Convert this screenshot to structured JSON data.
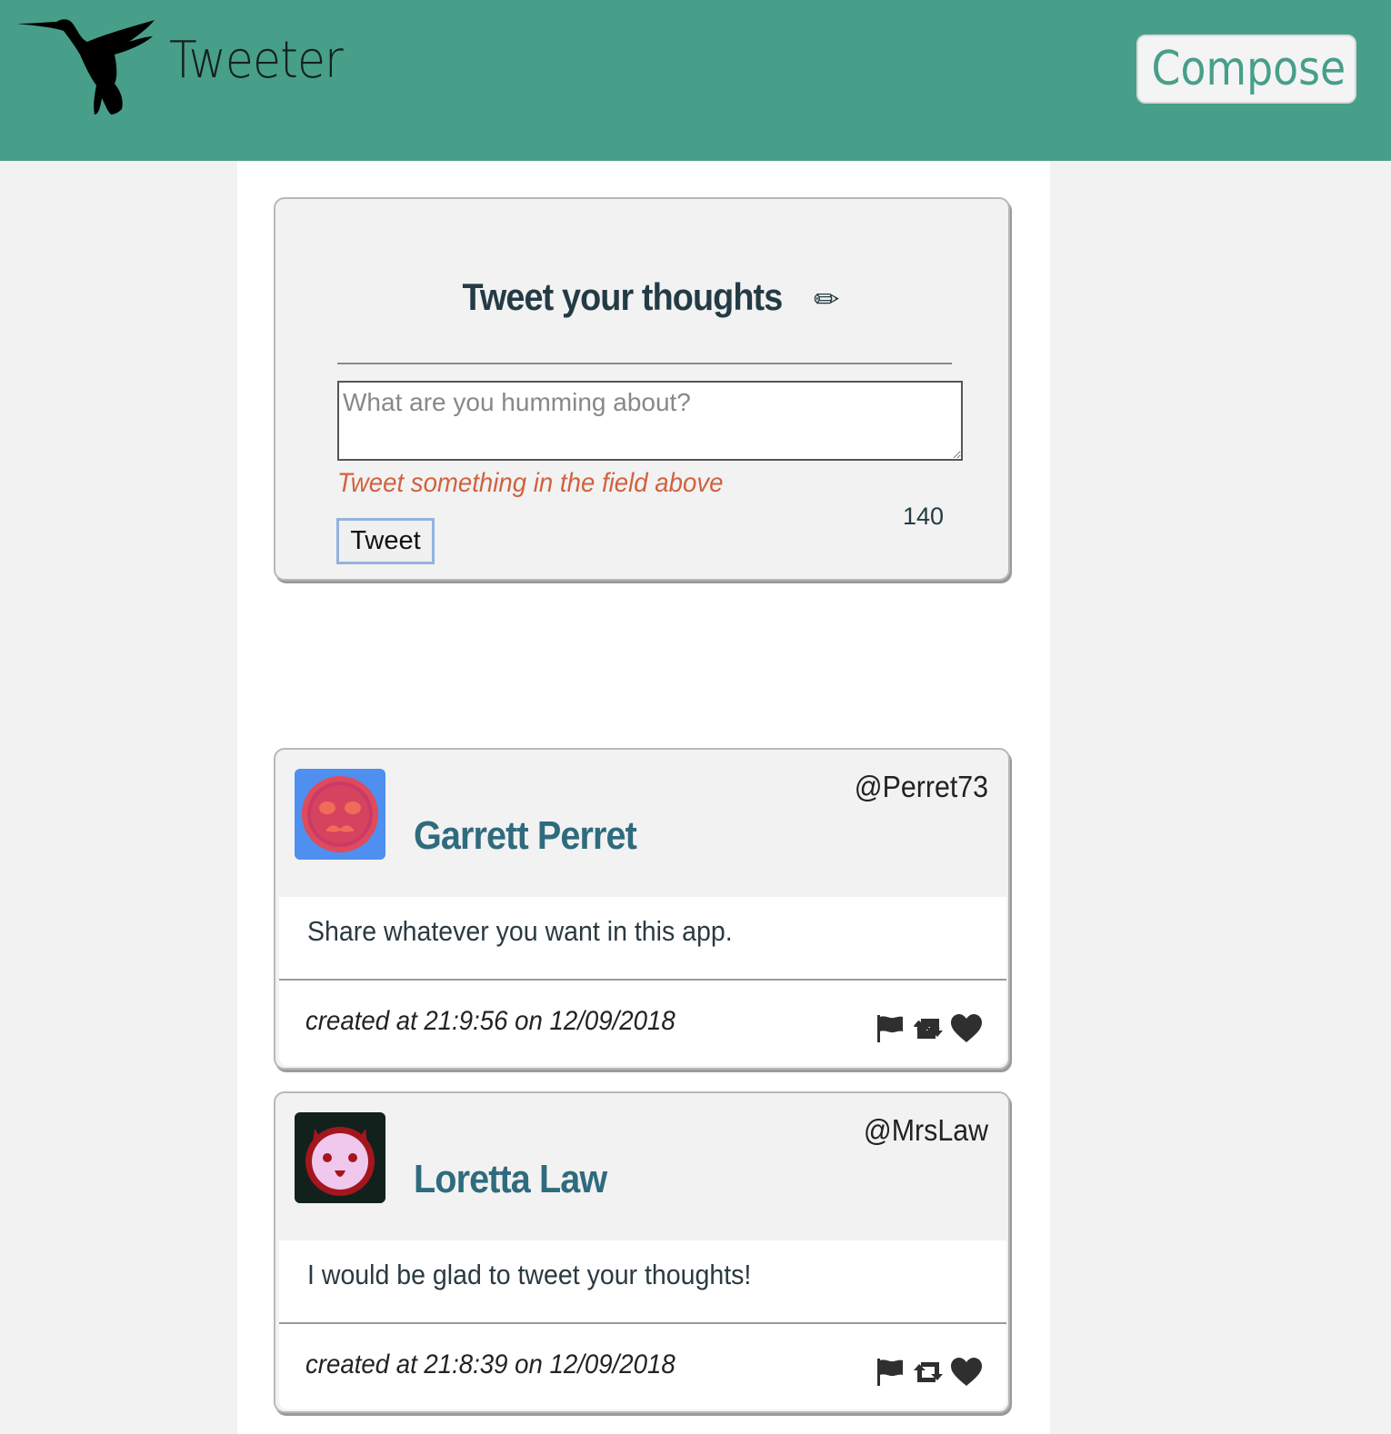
{
  "header": {
    "brand": "Tweeter",
    "compose_label": "Compose",
    "logo_icon": "hummingbird-icon",
    "color": "#479f89"
  },
  "new_tweet": {
    "title": "Tweet your thoughts",
    "title_icon": "pencil-icon",
    "title_glyph": "✏",
    "placeholder": "What are you humming about?",
    "value": "",
    "error": "Tweet something in the field above",
    "counter": "140",
    "submit_label": "Tweet"
  },
  "tweets": [
    {
      "name": "Garrett Perret",
      "handle": "@Perret73",
      "text": "Share whatever you want in this app.",
      "created": "created at 21:9:56 on 12/09/2018",
      "avatar": {
        "bg": "#4f8ff0",
        "face": "#e04a5a",
        "accent": "#b0265a"
      }
    },
    {
      "name": "Loretta Law",
      "handle": "@MrsLaw",
      "text": "I would be glad to tweet your thoughts!",
      "created": "created at 21:8:39 on 12/09/2018",
      "avatar": {
        "bg": "#12211c",
        "face": "#f0c8ee",
        "accent": "#a3161d"
      }
    }
  ],
  "actions": [
    "flag-icon",
    "retweet-icon",
    "heart-icon"
  ],
  "colors": {
    "name": "#2f6b7e",
    "error": "#d0623f",
    "action": "#2f2f2f"
  }
}
